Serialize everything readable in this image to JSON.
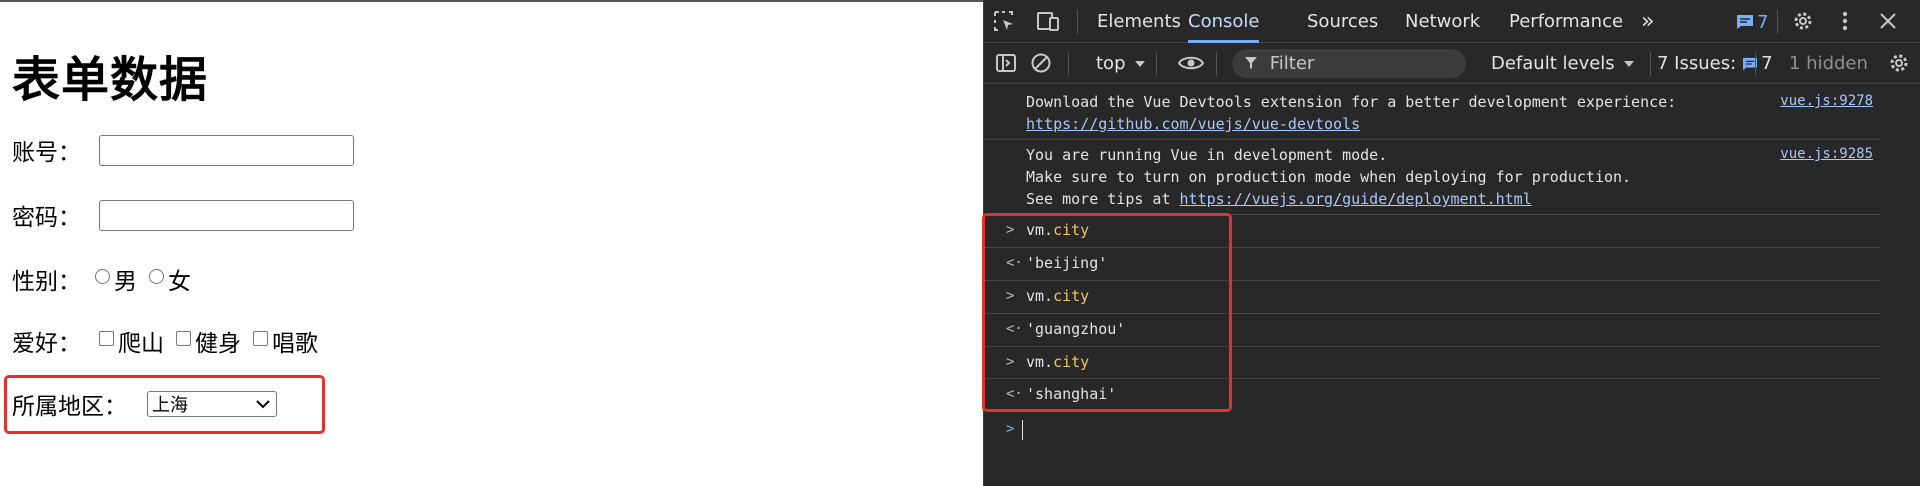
{
  "page": {
    "title": "表单数据",
    "account_label": "账号：",
    "password_label": "密码：",
    "gender_label": "性别：",
    "gender_options": [
      "男",
      "女"
    ],
    "hobby_label": "爱好：",
    "hobby_options": [
      "爬山",
      "健身",
      "唱歌"
    ],
    "region_label": "所属地区：",
    "region_selected": "上海"
  },
  "devtools": {
    "tabs": [
      "Elements",
      "Console",
      "Sources",
      "Network",
      "Performance"
    ],
    "active_tab": "Console",
    "more_tabs": "»",
    "messages_badge": "7",
    "context": "top",
    "filter_placeholder": "Filter",
    "levels": "Default levels",
    "issues_label": "7 Issues:",
    "issues_count": "7",
    "hidden": "1 hidden",
    "logs": [
      {
        "text": "Download the Vue Devtools extension for a better development experience:",
        "link": "https://github.com/vuejs/vue-devtools",
        "source": "vue.js:9278"
      },
      {
        "line1": "You are running Vue in development mode.",
        "line2": "Make sure to turn on production mode when deploying for production.",
        "line3_prefix": "See more tips at ",
        "link": "https://vuejs.org/guide/deployment.html",
        "source": "vue.js:9285"
      }
    ],
    "entries": [
      {
        "obj": "vm.",
        "prop": "city",
        "result": "'beijing'"
      },
      {
        "obj": "vm.",
        "prop": "city",
        "result": "'guangzhou'"
      },
      {
        "obj": "vm.",
        "prop": "city",
        "result": "'shanghai'"
      }
    ],
    "colors": {
      "background": "#282828",
      "accent": "#7cacf8",
      "highlight_box": "#e53030",
      "property": "#f2c55c",
      "string": "#5cd5fb"
    }
  }
}
